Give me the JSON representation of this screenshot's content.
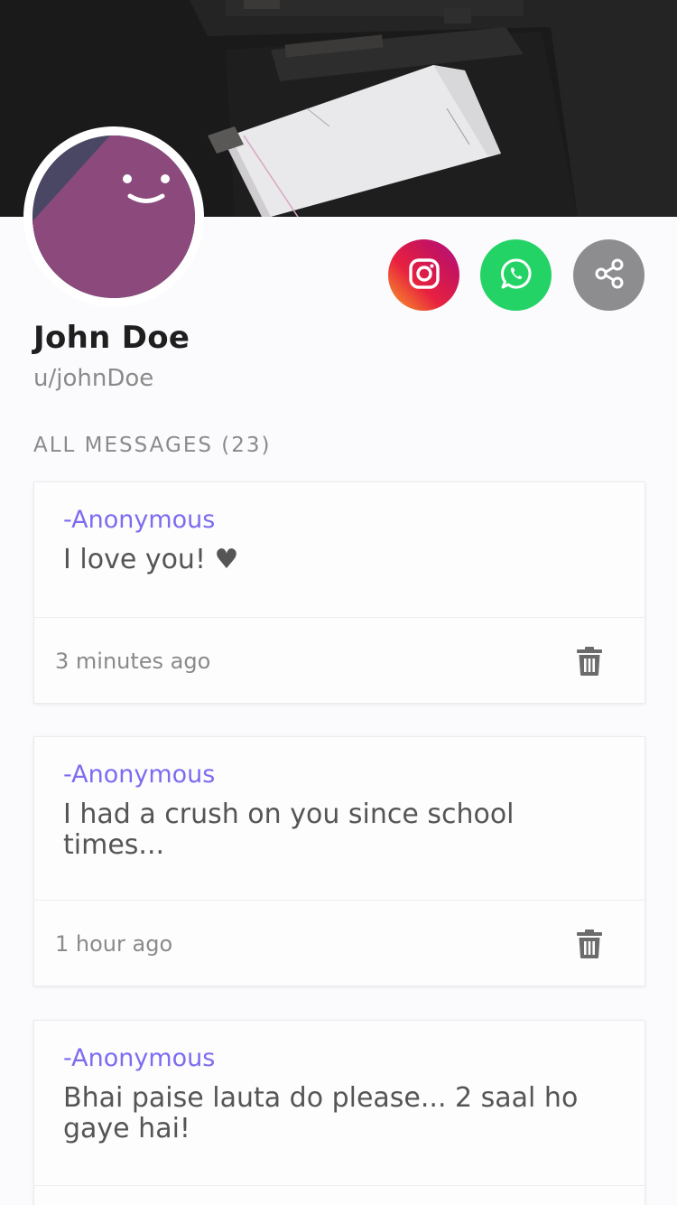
{
  "profile": {
    "name": "John Doe",
    "username": "u/johnDoe"
  },
  "social": {
    "instagram_icon": "instagram-icon",
    "whatsapp_icon": "whatsapp-icon",
    "share_icon": "share-icon",
    "colors": {
      "whatsapp": "#24d366",
      "share": "#8d8d8f",
      "instagram": "#e8213f"
    }
  },
  "messages_section": {
    "title": "ALL MESSAGES (23)"
  },
  "messages": [
    {
      "sender": "-Anonymous",
      "text": "I love you! ♥",
      "time": "3 minutes ago"
    },
    {
      "sender": "-Anonymous",
      "text": "I had a crush on you since school times...",
      "time": "1 hour ago"
    },
    {
      "sender": "-Anonymous",
      "text": "Bhai paise lauta do please... 2 saal ho gaye hai!",
      "time": ""
    }
  ],
  "theme": {
    "accent": "#7c6cf0",
    "avatar": "#8b4a7b"
  }
}
